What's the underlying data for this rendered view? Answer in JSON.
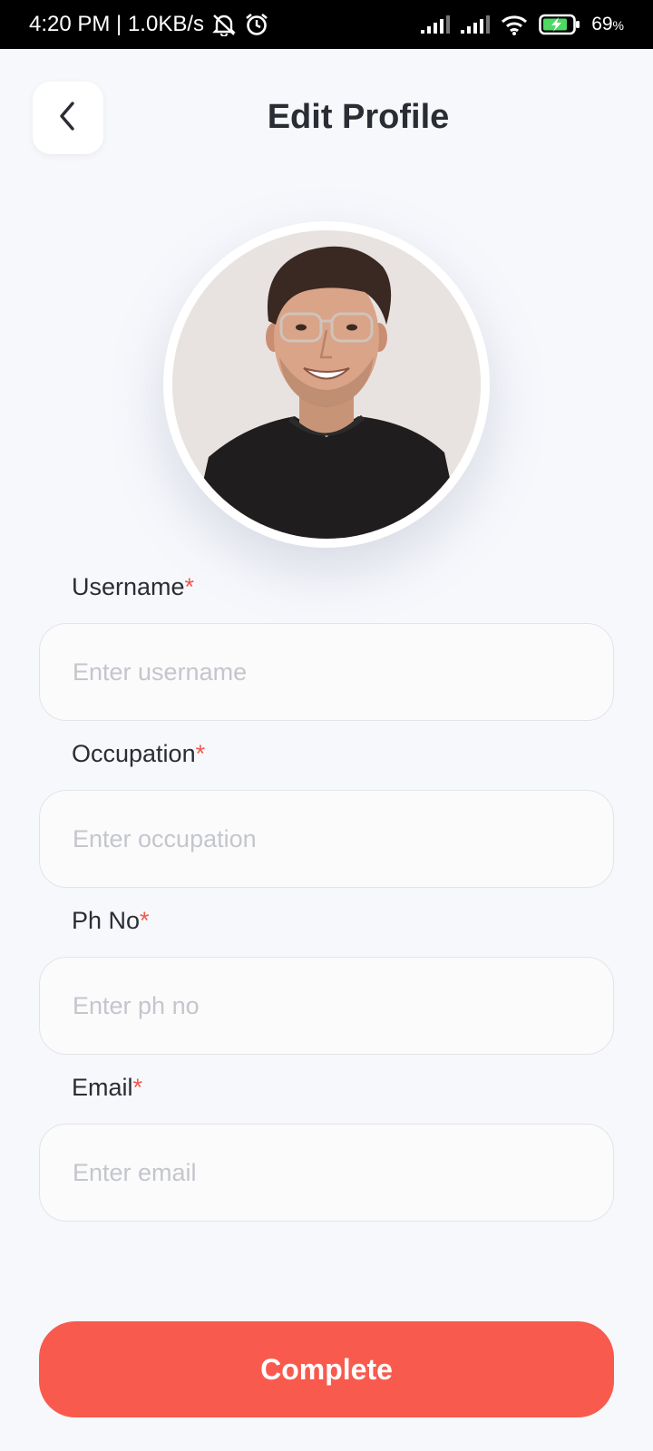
{
  "status_bar": {
    "time_speed": "4:20 PM | 1.0KB/s",
    "battery": "69",
    "battery_unit": "%",
    "icons": [
      "mute-icon",
      "alarm-icon",
      "signal-icon",
      "signal-icon",
      "wifi-icon",
      "battery-charging-icon"
    ]
  },
  "header": {
    "title": "Edit Profile",
    "back_icon": "chevron-left-icon"
  },
  "profile": {
    "avatar": "profile-photo"
  },
  "form": {
    "required_mark": "*",
    "fields": [
      {
        "label": "Username",
        "placeholder": "Enter username",
        "value": ""
      },
      {
        "label": "Occupation",
        "placeholder": "Enter occupation",
        "value": ""
      },
      {
        "label": "Ph No",
        "placeholder": "Enter ph no",
        "value": ""
      },
      {
        "label": "Email",
        "placeholder": "Enter email",
        "value": ""
      }
    ]
  },
  "actions": {
    "complete_label": "Complete"
  },
  "colors": {
    "accent": "#f85a4e",
    "required": "#f2574c",
    "background": "#f7f8fc"
  }
}
